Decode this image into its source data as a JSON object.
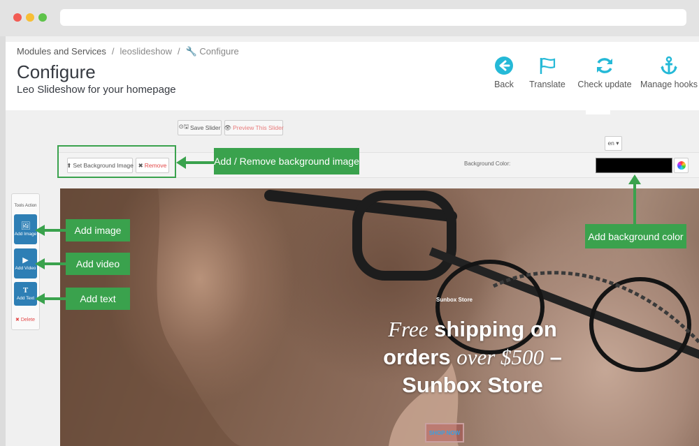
{
  "breadcrumb": {
    "item1": "Modules and Services",
    "item2": "leoslideshow",
    "item3": "Configure",
    "separator": "/"
  },
  "header": {
    "title": "Configure",
    "subtitle": "Leo Slideshow for your homepage"
  },
  "actions": {
    "back": "Back",
    "translate": "Translate",
    "check_update": "Check update",
    "manage_hooks": "Manage hooks"
  },
  "slider_toolbar": {
    "save": "Save Slider",
    "preview": "Preview This Slider",
    "lang": "en ▾",
    "set_background": "Set Background Image",
    "remove": "Remove",
    "background_color_label": "Background Color:",
    "background_color": "#000000"
  },
  "tools": {
    "title": "Tools Action",
    "add_image": "Add Image",
    "add_video": "Add Video",
    "add_text": "Add Text",
    "delete": "Delete"
  },
  "annotations": {
    "background_image": "Add / Remove background image",
    "add_image": "Add image",
    "add_video": "Add video",
    "add_text": "Add text",
    "background_color": "Add background color"
  },
  "slide": {
    "small_caption": "Sunbox Store",
    "line1_italic": "Free",
    "line1_bold": " shipping on",
    "line2_bold": "orders ",
    "line2_italic": "over $500",
    "line2_end": " –",
    "line3": "Sunbox Store",
    "button": "SHOP NOW"
  },
  "colors": {
    "accent_green": "#3aa24d",
    "action_blue": "#25b9d7",
    "tool_blue": "#2e7fb5"
  }
}
